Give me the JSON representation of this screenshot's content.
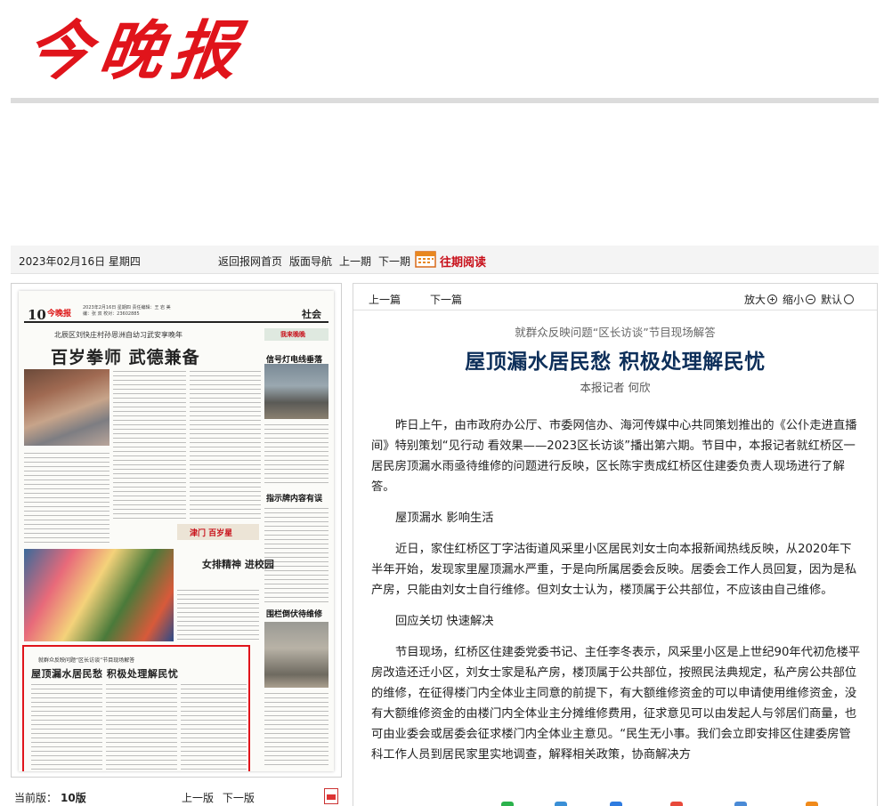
{
  "masthead": {
    "logo_text": "今晚报"
  },
  "toolbar": {
    "date": "2023年02月16日 星期四",
    "links": [
      "返回报网首页",
      "版面导航",
      "上一期",
      "下一期"
    ],
    "archive": "往期阅读"
  },
  "thumbnail": {
    "page_number": "10",
    "logo": "今晚报",
    "meta": "2023年2月16日 星期四 责任编辑：王 岩  美 编：张 双  校对：23602885",
    "section": "社会",
    "story1_subtitle": "北辰区刘快庄村孙恩洲自幼习武安享晚年",
    "story1_title": "百岁拳师 武德兼备",
    "side_heads": [
      "信号灯电线垂落",
      "指示牌内容有误",
      "围栏倒伏待维修"
    ],
    "side_tag": "我来晚晚",
    "tianjin_tag": "津门 百岁星",
    "nvquan_title": "女排精神 进校园",
    "highlight_subtitle": "就群众反映问题“区长访谈”节目现场解答",
    "highlight_title": "屋顶漏水居民愁 积极处理解民忧"
  },
  "page_footer": {
    "current_label": "当前版：",
    "current_value": "10版",
    "prev": "上一版",
    "next": "下一版"
  },
  "article_toolbar": {
    "prev": "上一篇",
    "next": "下一篇",
    "zoom_in": "放大",
    "zoom_out": "缩小",
    "default": "默认"
  },
  "article": {
    "subtitle": "就群众反映问题“区长访谈”节目现场解答",
    "title": "屋顶漏水居民愁 积极处理解民忧",
    "author": "本报记者 何欣",
    "paragraphs": [
      "昨日上午，由市政府办公厅、市委网信办、海河传媒中心共同策划推出的《公仆走进直播间》特别策划“见行动 看效果——2023区长访谈”播出第六期。节目中，本报记者就红桥区一居民房顶漏水雨亟待维修的问题进行反映，区长陈宇责成红桥区住建委负责人现场进行了解答。",
      "屋顶漏水 影响生活",
      "近日，家住红桥区丁字沽街道风采里小区居民刘女士向本报新闻热线反映，从2020年下半年开始，发现家里屋顶漏水严重，于是向所属居委会反映。居委会工作人员回复，因为是私产房，只能由刘女士自行维修。但刘女士认为，楼顶属于公共部位，不应该由自己维修。",
      "回应关切 快速解决",
      "节目现场，红桥区住建委党委书记、主任李冬表示，风采里小区是上世纪90年代初危楼平房改造还迁小区，刘女士家是私产房，楼顶属于公共部位，按照民法典规定，私产房公共部位的维修，在征得楼门内全体业主同意的前提下，有大额维修资金的可以申请使用维修资金，没有大额维修资金的由楼门内全体业主分摊维修费用，征求意见可以由发起人与邻居们商量，也可由业委会或居委会征求楼门内全体业主意见。“民生无小事。我们会立即安排区住建委房管科工作人员到居民家里实地调查，解释相关政策，协商解决方"
    ]
  },
  "colors": {
    "accent": "#e0141b",
    "title": "#0d2f5a",
    "archive": "#c8101a"
  }
}
